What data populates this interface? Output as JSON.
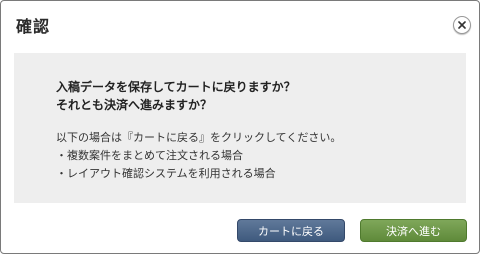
{
  "dialog": {
    "title": "確認",
    "close_icon": "close-icon"
  },
  "message": {
    "question_line1": "入稿データを保存してカートに戻りますか？",
    "question_line2": "それとも決済へ進みますか？",
    "info_intro": "以下の場合は『カートに戻る』をクリックしてください。",
    "info_items": [
      "・複数案件をまとめて注文される場合",
      "・レイアウト確認システムを利用される場合"
    ]
  },
  "buttons": {
    "cart_label": "カートに戻る",
    "pay_label": "決済へ進む"
  },
  "colors": {
    "cart_button": "#4a6587",
    "pay_button": "#6e9a48",
    "message_background": "#eeeeee"
  }
}
